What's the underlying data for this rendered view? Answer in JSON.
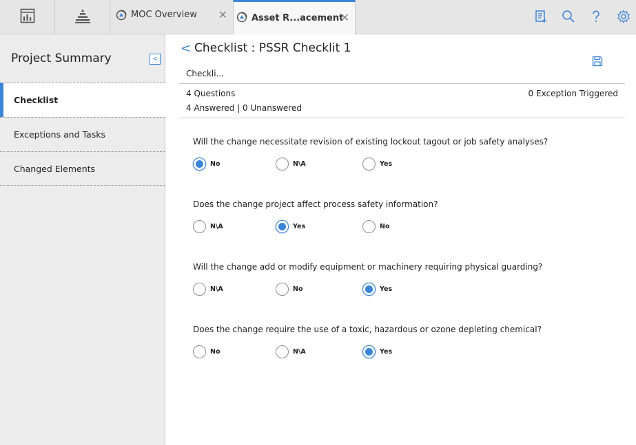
{
  "tabs": {
    "moc": {
      "label": "MOC Overview",
      "close": "✕"
    },
    "asset": {
      "label": "Asset R...acement",
      "close": "✕"
    }
  },
  "sidebar": {
    "title": "Project Summary",
    "collapse_glyph": "<",
    "items": [
      {
        "label": "Checklist"
      },
      {
        "label": "Exceptions and Tasks"
      },
      {
        "label": "Changed Elements"
      }
    ]
  },
  "main": {
    "back_glyph": "<",
    "title": "Checklist : PSSR Checklit 1",
    "subtab": "Checkli...",
    "questions_count": "4 Questions",
    "answered_summary": "4 Answered | 0 Unanswered",
    "exceptions": "0 Exception Triggered"
  },
  "questions": [
    {
      "text": "Will the change necessitate revision of existing lockout tagout or job safety analyses?",
      "options": [
        "No",
        "N\\A",
        "Yes"
      ],
      "selected": "No"
    },
    {
      "text": "Does the change project affect process safety information?",
      "options": [
        "N\\A",
        "Yes",
        "No"
      ],
      "selected": "Yes"
    },
    {
      "text": "Will the change add or modify equipment or machinery requiring physical guarding?",
      "options": [
        "N\\A",
        "No",
        "Yes"
      ],
      "selected": "Yes"
    },
    {
      "text": "Does the change require the use of a toxic, hazardous or ozone depleting chemical?",
      "options": [
        "No",
        "N\\A",
        "Yes"
      ],
      "selected": "Yes"
    }
  ],
  "colors": {
    "accent": "#3b85d8"
  }
}
